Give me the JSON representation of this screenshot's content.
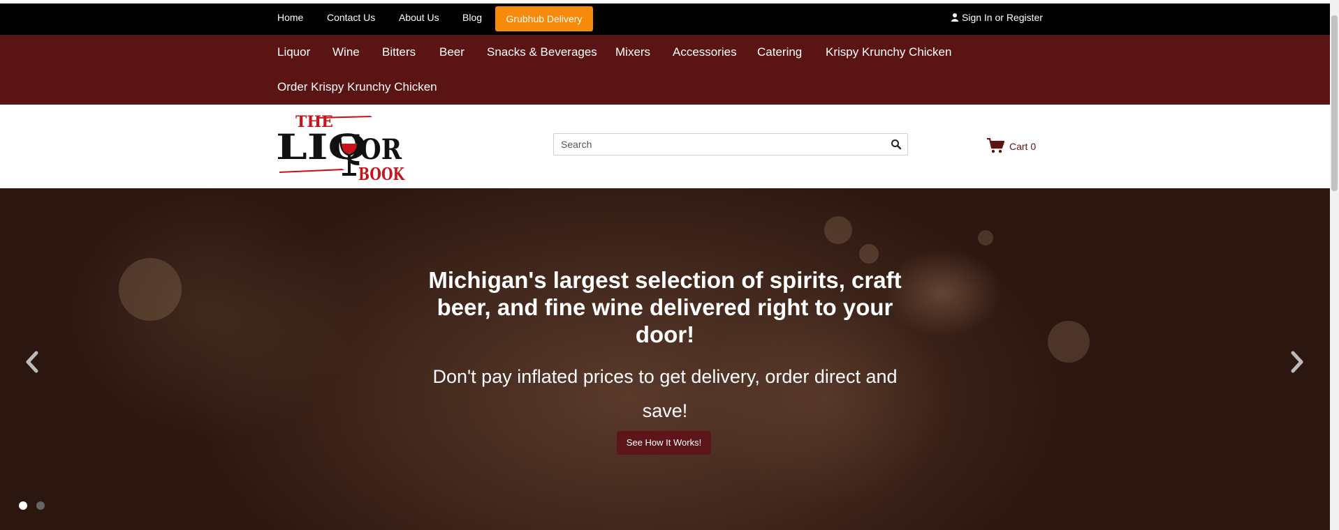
{
  "colors": {
    "top_bar_bg": "#000000",
    "category_nav_bg": "#5a1414",
    "grubhub_button_bg": "#f58a0b",
    "brand_dark_red": "#5a1414",
    "hero_button_bg": "#5c1518"
  },
  "top_nav": {
    "links": [
      "Home",
      "Contact Us",
      "About Us",
      "Blog"
    ],
    "grubhub_label": "Grubhub Delivery",
    "signin_label": "Sign In or Register",
    "signin_icon": "user-icon"
  },
  "category_nav": {
    "items": [
      "Liquor",
      "Wine",
      "Bitters",
      "Beer",
      "Snacks & Beverages",
      "Mixers",
      "Accessories",
      "Catering",
      "Krispy Krunchy Chicken",
      "Order Krispy Krunchy Chicken"
    ]
  },
  "header": {
    "logo_text": "THE LIQUOR BOOK",
    "search": {
      "placeholder": "Search",
      "value": "",
      "icon": "search-icon"
    },
    "cart": {
      "label": "Cart 0",
      "icon": "shopping-cart-icon"
    }
  },
  "hero": {
    "title": "Michigan's largest selection of spirits, craft beer, and fine wine delivered right to your door!",
    "subtitle": "Don't pay inflated prices to get delivery, order direct and save!",
    "button_label": "See How It Works!",
    "prev_icon": "chevron-left-icon",
    "next_icon": "chevron-right-icon",
    "slides_total": 2,
    "active_slide": 1
  }
}
